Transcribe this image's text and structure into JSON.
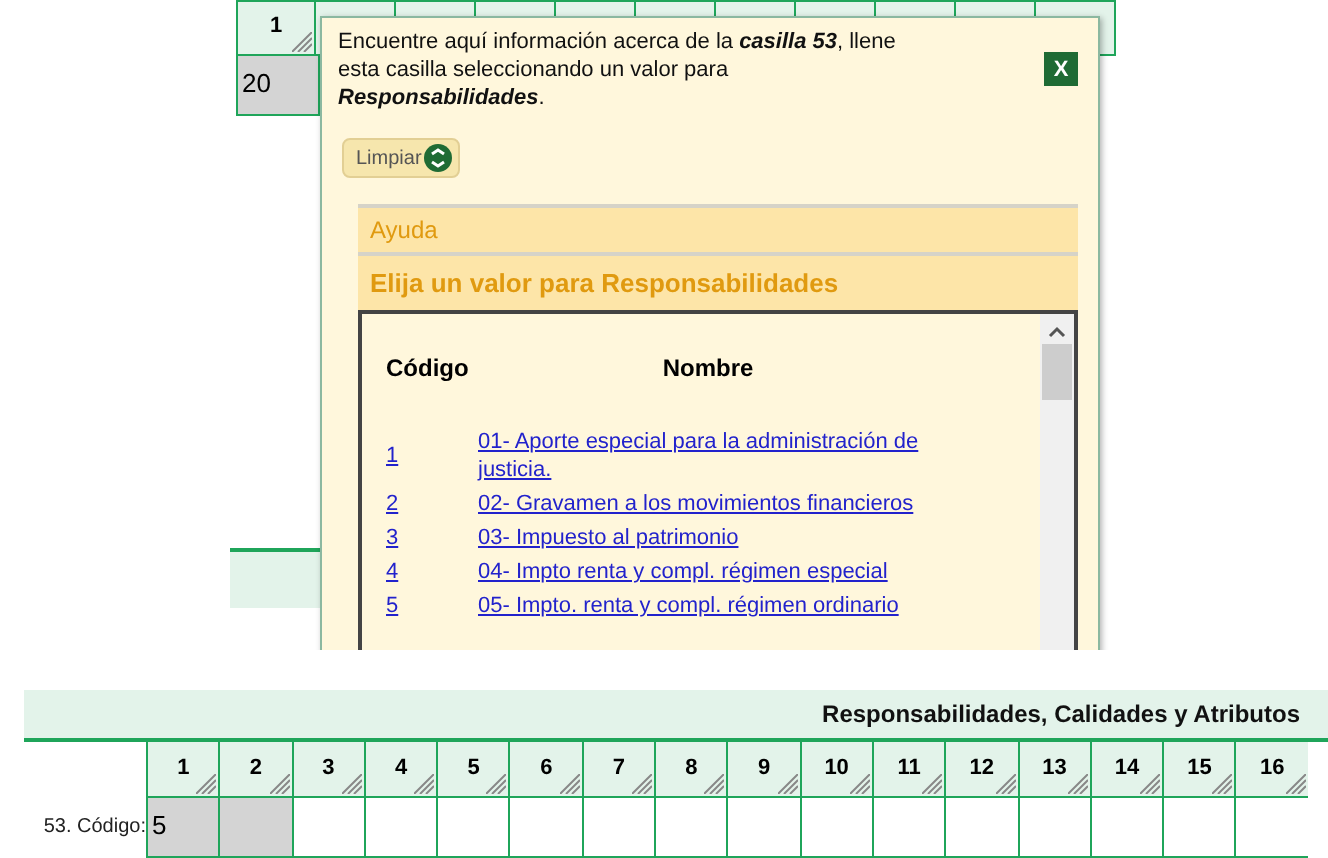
{
  "background_form": {
    "header_cell": "1",
    "value_cell": "20"
  },
  "popup": {
    "intro": "Encuentre aquí información acerca de la **casilla 53**, llene esta casilla seleccionando un valor para **Responsabilidades**.",
    "close_button": "X",
    "clear_button": "Limpiar",
    "help_tab": "Ayuda",
    "list_title": "Elija un valor para Responsabilidades",
    "columns": [
      "Código",
      "Nombre"
    ],
    "options": [
      {
        "code": "1",
        "name": "01- Aporte especial para la administración de justicia."
      },
      {
        "code": "2",
        "name": "02- Gravamen a los movimientos financieros"
      },
      {
        "code": "3",
        "name": "03- Impuesto al patrimonio"
      },
      {
        "code": "4",
        "name": "04- Impto renta y compl. régimen especial"
      },
      {
        "code": "5",
        "name": "05- Impto. renta y compl. régimen ordinario"
      }
    ]
  },
  "section": {
    "title": "Responsabilidades, Calidades y Atributos",
    "row_label": "53. Código:",
    "columns": [
      "1",
      "2",
      "3",
      "4",
      "5",
      "6",
      "7",
      "8",
      "9",
      "10",
      "11",
      "12",
      "13",
      "14",
      "15",
      "16"
    ],
    "cells": [
      {
        "value": "5",
        "shaded": true
      },
      {
        "shaded": true
      },
      {
        "shaded": false
      },
      {
        "shaded": false
      },
      {
        "shaded": false
      },
      {
        "shaded": false
      },
      {
        "shaded": false
      },
      {
        "shaded": false
      },
      {
        "shaded": false
      },
      {
        "shaded": false
      },
      {
        "shaded": false
      },
      {
        "shaded": false
      },
      {
        "shaded": false
      },
      {
        "shaded": false
      },
      {
        "shaded": false
      },
      {
        "shaded": false
      }
    ]
  }
}
